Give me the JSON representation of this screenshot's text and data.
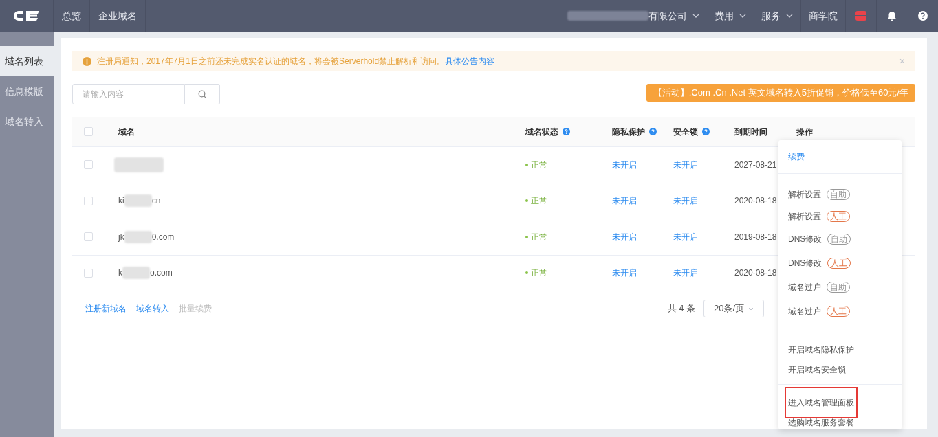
{
  "topbar": {
    "nav": [
      {
        "label": "总览"
      },
      {
        "label": "企业域名"
      }
    ],
    "right": [
      {
        "label": "有限公司",
        "kind": "blurred_dropdown"
      },
      {
        "label": "费用",
        "kind": "dropdown"
      },
      {
        "label": "服务",
        "kind": "dropdown"
      },
      {
        "label": "商学院",
        "kind": "link"
      }
    ]
  },
  "sidebar": {
    "items": [
      {
        "label": "域名列表",
        "selected": true
      },
      {
        "label": "信息模版",
        "selected": false
      },
      {
        "label": "域名转入",
        "selected": false
      }
    ]
  },
  "notice": {
    "text": "注册局通知，2017年7月1日之前还未完成实名认证的域名，将会被Serverhold禁止解析和访问。",
    "link": "具体公告内容",
    "close": "×"
  },
  "search": {
    "placeholder": "请输入内容"
  },
  "promo": "【活动】.Com .Cn .Net 英文域名转入5折促销，价格低至60元/年",
  "table": {
    "select_all_checked": false,
    "columns": [
      {
        "label": "域名",
        "help": false
      },
      {
        "label": "域名状态",
        "help": true
      },
      {
        "label": "隐私保护",
        "help": true
      },
      {
        "label": "安全锁",
        "help": true
      },
      {
        "label": "到期时间",
        "help": false
      },
      {
        "label": "操作",
        "help": false
      }
    ],
    "rows": [
      {
        "domain_start": "",
        "domain_end": "",
        "status": "正常",
        "privacy": "未开启",
        "lock": "未开启",
        "expiry": "2027-08-21",
        "checked": false
      },
      {
        "domain_start": "ki",
        "domain_end": "cn",
        "status": "正常",
        "privacy": "未开启",
        "lock": "未开启",
        "expiry": "2020-08-18",
        "checked": false
      },
      {
        "domain_start": "jk",
        "domain_end": "0.com",
        "status": "正常",
        "privacy": "未开启",
        "lock": "未开启",
        "expiry": "2019-08-18",
        "checked": false
      },
      {
        "domain_start": "k",
        "domain_end": "o.com",
        "status": "正常",
        "privacy": "未开启",
        "lock": "未开启",
        "expiry": "2020-08-18",
        "checked": false
      }
    ]
  },
  "footer": {
    "actions": [
      {
        "label": "注册新域名",
        "disabled": false
      },
      {
        "label": "域名转入",
        "disabled": false
      },
      {
        "label": "批量续费",
        "disabled": true
      }
    ],
    "total": "共 4 条",
    "page_size": "20条/页"
  },
  "menu": {
    "groups": [
      [
        {
          "label": "续费",
          "kind": "link"
        }
      ],
      [
        {
          "label": "解析设置",
          "tag": "自助",
          "color": "#999999"
        },
        {
          "label": "解析设置",
          "tag": "人工",
          "color": "#e4774a"
        },
        {
          "label": "DNS修改",
          "tag": "自助",
          "color": "#999999"
        },
        {
          "label": "DNS修改",
          "tag": "人工",
          "color": "#e4774a"
        },
        {
          "label": "域名过户",
          "tag": "自助",
          "color": "#999999"
        },
        {
          "label": "域名过户",
          "tag": "人工",
          "color": "#e4774a"
        }
      ],
      [
        {
          "label": "开启域名隐私保护"
        },
        {
          "label": "开启域名安全锁"
        }
      ],
      [
        {
          "label": "进入域名管理面板",
          "highlighted": true
        },
        {
          "label": "选购域名服务套餐",
          "highlighted": false
        }
      ]
    ]
  }
}
